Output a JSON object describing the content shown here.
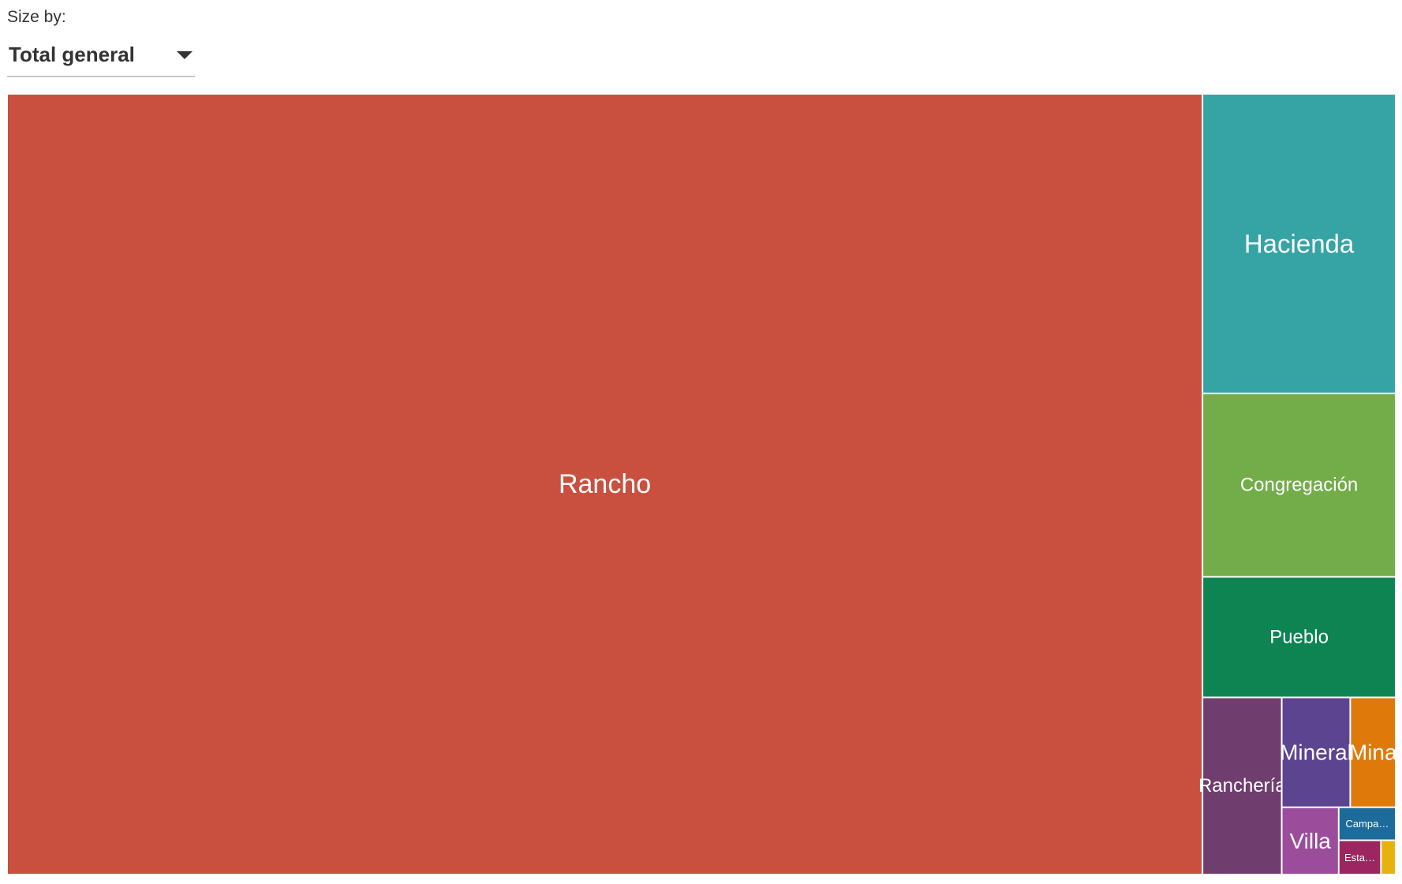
{
  "controls": {
    "size_by_label": "Size by:",
    "size_by_value": "Total general",
    "dropdown_icon": "chevron-down-icon"
  },
  "chart_data": {
    "type": "treemap",
    "title": "",
    "value_field": "Total general",
    "items": [
      {
        "label": "Rancho",
        "display_label": "Rancho",
        "value": 12900,
        "color": "#c9503f"
      },
      {
        "label": "Hacienda",
        "display_label": "Hacienda",
        "value": 800,
        "color": "#36a3a5"
      },
      {
        "label": "Congregación",
        "display_label": "Congregación",
        "value": 490,
        "color": "#73ad4a"
      },
      {
        "label": "Pueblo",
        "display_label": "Pueblo",
        "value": 322,
        "color": "#0e8452"
      },
      {
        "label": "Ranchería",
        "display_label": "Ranchería",
        "value": 194,
        "color": "#6f3e6e"
      },
      {
        "label": "Mineral",
        "display_label": "Mineral",
        "value": 104,
        "color": "#5d4490"
      },
      {
        "label": "Mina",
        "display_label": "Mina",
        "value": 69,
        "color": "#df7a0a"
      },
      {
        "label": "Villa",
        "display_label": "Villa",
        "value": 53,
        "color": "#9b4d9b"
      },
      {
        "label": "Campa…",
        "display_label": "Campa…",
        "value": 26,
        "color": "#1d6b9a"
      },
      {
        "label": "Esta…",
        "display_label": "Esta…",
        "value": 20,
        "color": "#9d2560"
      },
      {
        "label": "",
        "display_label": "",
        "value": 7,
        "color": "#e6b20c"
      }
    ]
  }
}
